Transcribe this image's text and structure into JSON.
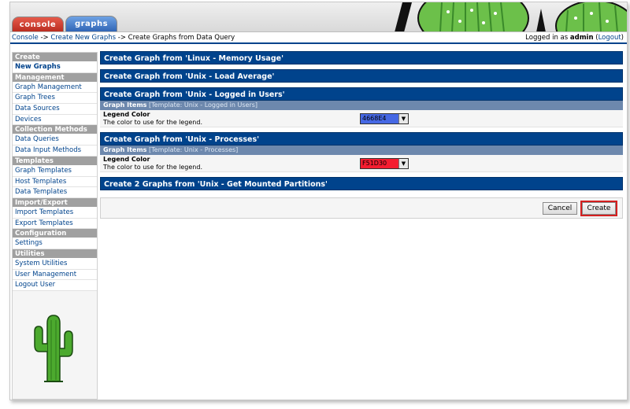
{
  "tabs": [
    {
      "label": "console"
    },
    {
      "label": "graphs"
    }
  ],
  "breadcrumb": {
    "console": "Console",
    "sep1": " -> ",
    "create_new_graphs": "Create New Graphs",
    "sep2": " -> ",
    "current": "Create Graphs from Data Query"
  },
  "login": {
    "prefix": "Logged in as ",
    "user": "admin",
    "open": " (",
    "logout": "Logout",
    "close": ")"
  },
  "sidebar": {
    "groups": [
      {
        "header": "Create",
        "items": [
          "New Graphs"
        ]
      },
      {
        "header": "Management",
        "items": [
          "Graph Management",
          "Graph Trees",
          "Data Sources",
          "Devices"
        ]
      },
      {
        "header": "Collection Methods",
        "items": [
          "Data Queries",
          "Data Input Methods"
        ]
      },
      {
        "header": "Templates",
        "items": [
          "Graph Templates",
          "Host Templates",
          "Data Templates"
        ]
      },
      {
        "header": "Import/Export",
        "items": [
          "Import Templates",
          "Export Templates"
        ]
      },
      {
        "header": "Configuration",
        "items": [
          "Settings"
        ]
      },
      {
        "header": "Utilities",
        "items": [
          "System Utilities",
          "User Management",
          "Logout User"
        ]
      }
    ]
  },
  "sections": [
    {
      "title": "Create Graph from 'Linux - Memory Usage'"
    },
    {
      "title": "Create Graph from 'Unix - Load Average'"
    },
    {
      "title": "Create Graph from 'Unix - Logged in Users'",
      "sub_header_label": "Graph Items",
      "sub_header_template": "[Template: Unix - Logged in Users]",
      "field_label": "Legend Color",
      "field_desc": "The color to use for the legend.",
      "color_value": "4668E4",
      "color_hex": "#4668E4"
    },
    {
      "title": "Create Graph from 'Unix - Processes'",
      "sub_header_label": "Graph Items",
      "sub_header_template": "[Template: Unix - Processes]",
      "field_label": "Legend Color",
      "field_desc": "The color to use for the legend.",
      "color_value": "F51D30",
      "color_hex": "#F51D30"
    },
    {
      "title": "Create 2 Graphs from 'Unix - Get Mounted Partitions'"
    }
  ],
  "buttons": {
    "cancel": "Cancel",
    "create": "Create"
  },
  "colors": {
    "header_blue": "#00438C",
    "subheader": "#6D88AD",
    "sidebar_header": "#A0A0A0",
    "highlight_red": "#D41F1F"
  }
}
